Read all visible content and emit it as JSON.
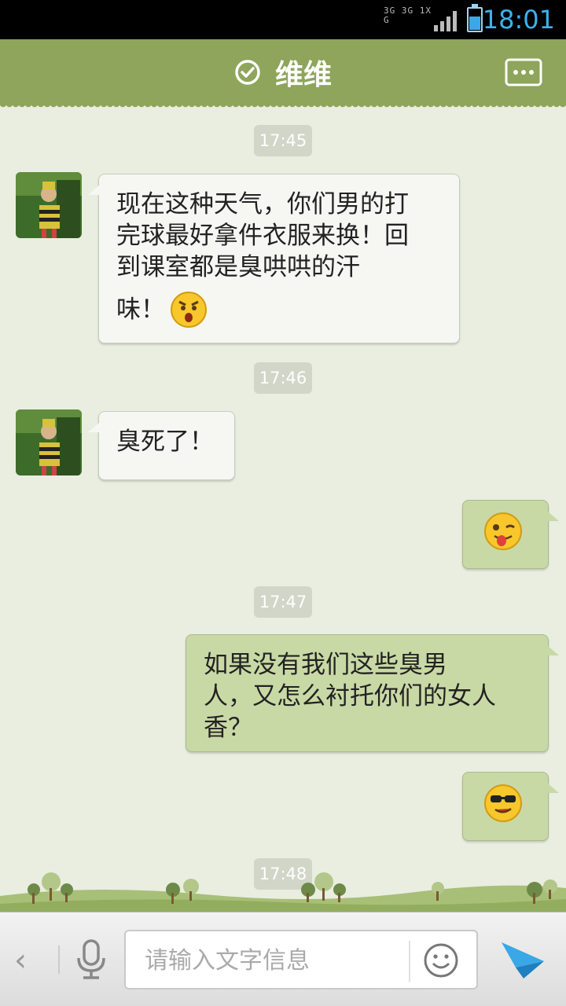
{
  "status_bar": {
    "network": "3G 3G 1X G",
    "time": "18:01"
  },
  "header": {
    "title": "维维"
  },
  "messages": [
    {
      "type": "time",
      "text": "17:45"
    },
    {
      "type": "in",
      "text_lines": [
        "现在这种天气，你们男的打",
        "完球最好拿件衣服来换！回",
        "到课室都是臭哄哄的汗",
        "味！"
      ],
      "emoji": "angry-face"
    },
    {
      "type": "time",
      "text": "17:46"
    },
    {
      "type": "in",
      "text_lines": [
        "臭死了！"
      ]
    },
    {
      "type": "out",
      "emoji": "tongue-wink-face"
    },
    {
      "type": "time",
      "text": "17:47"
    },
    {
      "type": "out",
      "text_lines": [
        "如果没有我们这些臭男",
        "人，又怎么衬托你们的女人",
        "香？"
      ]
    },
    {
      "type": "out",
      "emoji": "cool-sunglasses-face"
    },
    {
      "type": "time",
      "text": "17:48"
    }
  ],
  "input": {
    "placeholder": "请输入文字信息"
  },
  "colors": {
    "header": "#8ea55b",
    "chat_background": "#e9eee0",
    "bubble_in": "#f6f7f3",
    "bubble_out": "#c9d9a5",
    "accent_blue": "#3aa7e6"
  }
}
